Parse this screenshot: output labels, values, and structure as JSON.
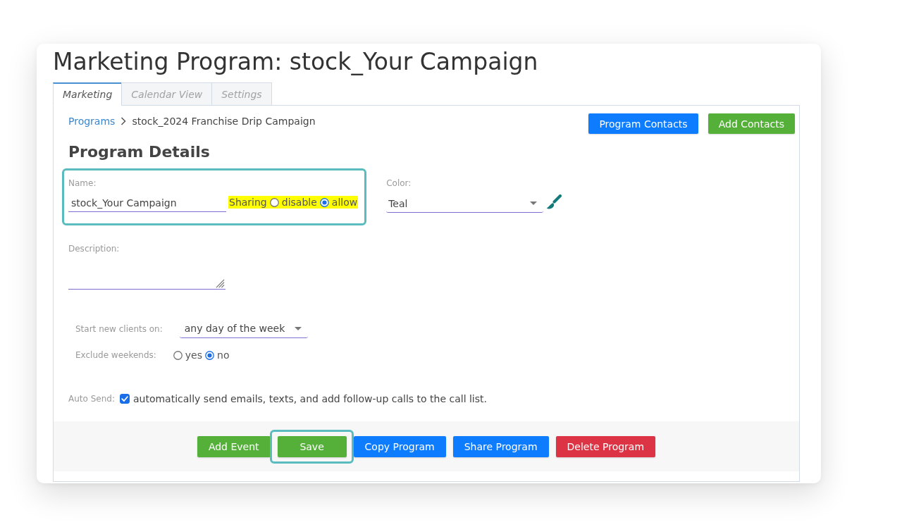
{
  "window": {
    "title": "Marketing Program: stock_Your Campaign"
  },
  "tabs": [
    {
      "label": "Marketing",
      "selected": true
    },
    {
      "label": "Calendar View",
      "selected": false
    },
    {
      "label": "Settings",
      "selected": false
    }
  ],
  "breadcrumb": [
    {
      "label": "Programs",
      "kind": "link"
    },
    {
      "label": "stock_2024 Franchise Drip Campaign",
      "kind": "current"
    }
  ],
  "header_buttons": [
    {
      "label": "Program Contacts",
      "kind": "primary"
    },
    {
      "label": "Add Contacts",
      "kind": "success"
    }
  ],
  "section_title": "Program Details",
  "name_field": {
    "label": "Name:",
    "value": "stock_Your Campaign",
    "highlighted": true
  },
  "sharing": {
    "label": "Sharing",
    "highlighted": true,
    "options": [
      {
        "label": "disable",
        "selected": false
      },
      {
        "label": "allow",
        "selected": true
      }
    ]
  },
  "color_field": {
    "label": "Color:",
    "value": "Teal"
  },
  "description_field": {
    "label": "Description:"
  },
  "start_clients": {
    "label": "Start new clients on:",
    "value": "any day of the week"
  },
  "exclude_weekends": {
    "label": "Exclude weekends:",
    "options": [
      {
        "label": "yes",
        "selected": false
      },
      {
        "label": "no",
        "selected": true
      }
    ]
  },
  "auto_send": {
    "label": "Auto Send:",
    "checked": true,
    "text": "automatically send emails, texts, and add follow-up calls to the call list."
  },
  "footer_buttons": [
    {
      "label": "Add Event",
      "kind": "success",
      "highlighted": false
    },
    {
      "label": "Save",
      "kind": "success",
      "highlighted": true
    },
    {
      "label": "Copy Program",
      "kind": "primary",
      "highlighted": false
    },
    {
      "label": "Share Program",
      "kind": "primary",
      "highlighted": false
    },
    {
      "label": "Delete Program",
      "kind": "danger",
      "highlighted": false
    }
  ]
}
